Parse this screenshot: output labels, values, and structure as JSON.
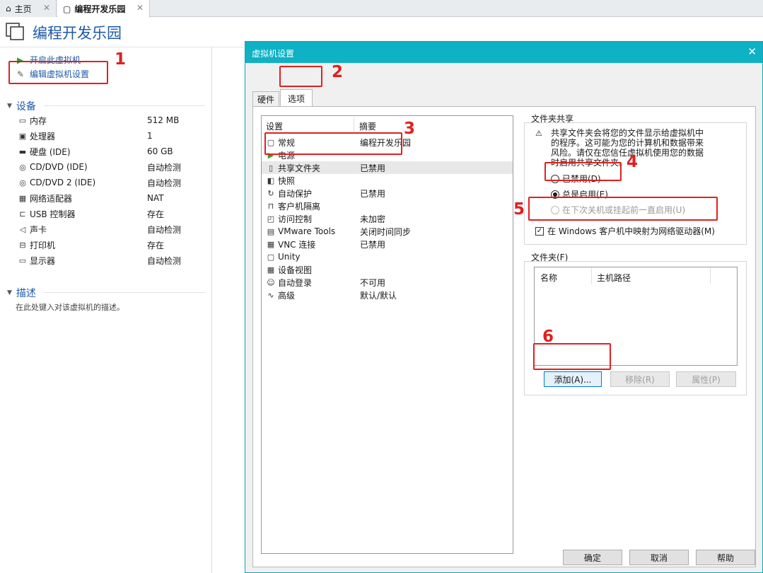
{
  "tabs": [
    {
      "label": "主页",
      "icon": "home-icon",
      "active": false
    },
    {
      "label": "编程开发乐园",
      "icon": "vm-icon",
      "active": true
    }
  ],
  "header": {
    "title": "编程开发乐园",
    "icon": "vm-stack-icon"
  },
  "commands": [
    {
      "label": "开启此虚拟机",
      "icon": "play-icon"
    },
    {
      "label": "编辑虚拟机设置",
      "icon": "edit-settings-icon"
    }
  ],
  "devices_section": {
    "title": "设备",
    "items": [
      {
        "name": "内存",
        "value": "512 MB",
        "icon": "memory-icon"
      },
      {
        "name": "处理器",
        "value": "1",
        "icon": "cpu-icon"
      },
      {
        "name": "硬盘 (IDE)",
        "value": "60 GB",
        "icon": "hard-disk-icon"
      },
      {
        "name": "CD/DVD (IDE)",
        "value": "自动检测",
        "icon": "cd-icon"
      },
      {
        "name": "CD/DVD 2 (IDE)",
        "value": "自动检测",
        "icon": "cd-icon"
      },
      {
        "name": "网络适配器",
        "value": "NAT",
        "icon": "network-icon"
      },
      {
        "name": "USB 控制器",
        "value": "存在",
        "icon": "usb-icon"
      },
      {
        "name": "声卡",
        "value": "自动检测",
        "icon": "speaker-icon"
      },
      {
        "name": "打印机",
        "value": "存在",
        "icon": "printer-icon"
      },
      {
        "name": "显示器",
        "value": "自动检测",
        "icon": "monitor-icon"
      }
    ]
  },
  "description_section": {
    "title": "描述",
    "hint": "在此处键入对该虚拟机的描述。"
  },
  "dialog": {
    "title": "虚拟机设置",
    "tabs": [
      "硬件",
      "选项"
    ],
    "list_headers": {
      "setting": "设置",
      "summary": "摘要"
    },
    "settings": [
      {
        "name": "常规",
        "summary": "编程开发乐园",
        "icon": "general-icon"
      },
      {
        "name": "电源",
        "summary": "",
        "icon": "power-icon"
      },
      {
        "name": "共享文件夹",
        "summary": "已禁用",
        "icon": "shared-folder-icon"
      },
      {
        "name": "快照",
        "summary": "",
        "icon": "snapshot-icon"
      },
      {
        "name": "自动保护",
        "summary": "已禁用",
        "icon": "autoprotect-icon"
      },
      {
        "name": "客户机隔离",
        "summary": "",
        "icon": "lock-icon"
      },
      {
        "name": "访问控制",
        "summary": "未加密",
        "icon": "access-control-icon"
      },
      {
        "name": "VMware Tools",
        "summary": "关闭时间同步",
        "icon": "vmware-tools-icon"
      },
      {
        "name": "VNC 连接",
        "summary": "已禁用",
        "icon": "vnc-icon"
      },
      {
        "name": "Unity",
        "summary": "",
        "icon": "unity-icon"
      },
      {
        "name": "设备视图",
        "summary": "",
        "icon": "device-view-icon"
      },
      {
        "name": "自动登录",
        "summary": "不可用",
        "icon": "autologin-icon"
      },
      {
        "name": "高级",
        "summary": "默认/默认",
        "icon": "advanced-icon"
      }
    ],
    "folder_sharing": {
      "group_title": "文件夹共享",
      "warning_lines": [
        "共享文件夹会将您的文件显示给虚拟机中",
        "的程序。这可能为您的计算机和数据带来",
        "风险。请仅在您信任虚拟机使用您的数据",
        "时启用共享文件夹。"
      ],
      "option_disabled": "已禁用(D)",
      "option_always": "总是启用(E)",
      "option_until": "在下次关机或挂起前一直启用(U)",
      "map_drive": "在 Windows 客户机中映射为网络驱动器(M)",
      "selected": "总是启用(E)",
      "map_drive_checked": true
    },
    "folders": {
      "group_title": "文件夹(F)",
      "columns": [
        "名称",
        "主机路径"
      ],
      "add": "添加(A)...",
      "remove": "移除(R)",
      "properties": "属性(P)"
    },
    "buttons": {
      "ok": "确定",
      "cancel": "取消",
      "help": "帮助"
    }
  },
  "annotations": [
    "1",
    "2",
    "3",
    "4",
    "5",
    "6"
  ],
  "colors": {
    "accent": "#1e5aa8",
    "dialog_titlebar": "#0fb1c4",
    "annotation": "#e02020"
  }
}
